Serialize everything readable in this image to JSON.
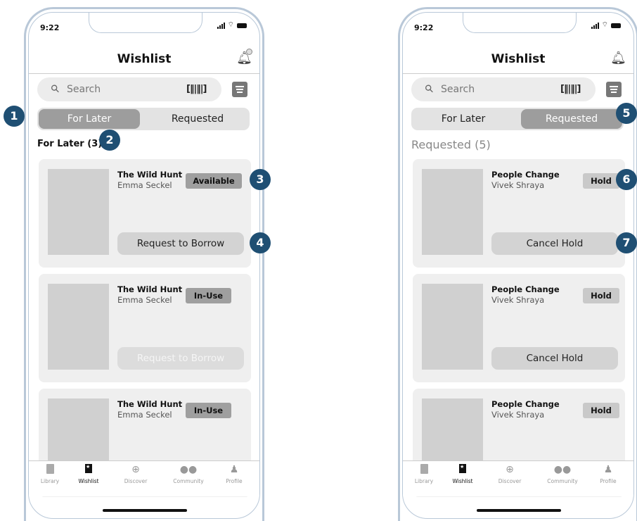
{
  "left": {
    "status_time": "9:22",
    "title": "Wishlist",
    "search_placeholder": "Search",
    "segments": [
      "For Later",
      "Requested"
    ],
    "active_segment": 0,
    "section_title": "For Later (3)",
    "books": [
      {
        "title": "The Wild Hunt",
        "author": "Emma Seckel",
        "status": "Available",
        "action": "Request to Borrow",
        "action_enabled": true
      },
      {
        "title": "The Wild Hunt",
        "author": "Emma Seckel",
        "status": "In-Use",
        "action": "Request to Borrow",
        "action_enabled": false
      },
      {
        "title": "The Wild Hunt",
        "author": "Emma Seckel",
        "status": "In-Use"
      }
    ]
  },
  "right": {
    "status_time": "9:22",
    "title": "Wishlist",
    "search_placeholder": "Search",
    "segments": [
      "For Later",
      "Requested"
    ],
    "active_segment": 1,
    "section_title": "Requested (5)",
    "books": [
      {
        "title": "People Change",
        "author": "Vivek Shraya",
        "status": "Hold",
        "action": "Cancel Hold",
        "action_enabled": true
      },
      {
        "title": "People Change",
        "author": "Vivek Shraya",
        "status": "Hold",
        "action": "Cancel Hold",
        "action_enabled": true
      },
      {
        "title": "People Change",
        "author": "Vivek Shraya",
        "status": "Hold"
      }
    ]
  },
  "tabbar": {
    "items": [
      {
        "label": "Library",
        "icon": "library-icon"
      },
      {
        "label": "Wishlist",
        "icon": "wishlist-icon",
        "active": true
      },
      {
        "label": "Discover",
        "icon": "globe-icon"
      },
      {
        "label": "Community",
        "icon": "community-icon"
      },
      {
        "label": "Profile",
        "icon": "profile-icon"
      }
    ]
  },
  "callouts": [
    "1",
    "2",
    "3",
    "4",
    "5",
    "6",
    "7"
  ],
  "colors": {
    "callout": "#1f4f73",
    "frame": "#b9c8d8",
    "active_segment": "#9d9d9d",
    "badge": "#9f9f9f"
  }
}
